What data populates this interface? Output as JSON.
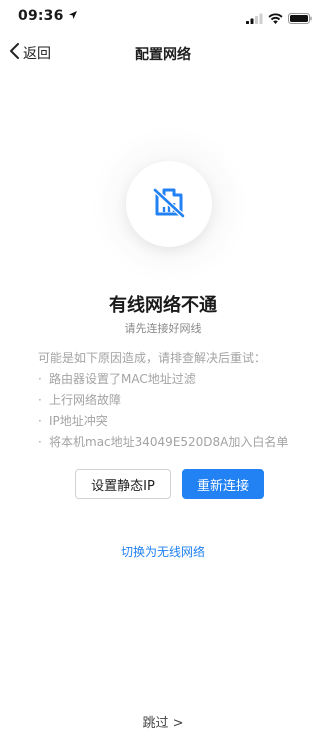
{
  "status_bar": {
    "time": "09:36",
    "location_icon": "location-arrow-icon",
    "signal_icon": "signal-icon",
    "wifi_icon": "wifi-icon",
    "battery_icon": "battery-icon"
  },
  "nav": {
    "back_label": "返回",
    "title": "配置网络"
  },
  "illustration": {
    "icon": "wired-network-off-icon",
    "accent_color": "#2281f3"
  },
  "error": {
    "title": "有线网络不通",
    "subtitle": "请先连接好网线",
    "reasons_intro": "可能是如下原因造成，请排查解决后重试：",
    "reasons": [
      "路由器设置了MAC地址过滤",
      "上行网络故障",
      "IP地址冲突",
      "将本机mac地址34049E520D8A加入白名单"
    ]
  },
  "actions": {
    "static_ip_label": "设置静态IP",
    "reconnect_label": "重新连接",
    "switch_wireless_label": "切换为无线网络",
    "skip_label": "跳过 >"
  },
  "colors": {
    "primary": "#2281f3",
    "muted_text": "#a3a3a3"
  }
}
